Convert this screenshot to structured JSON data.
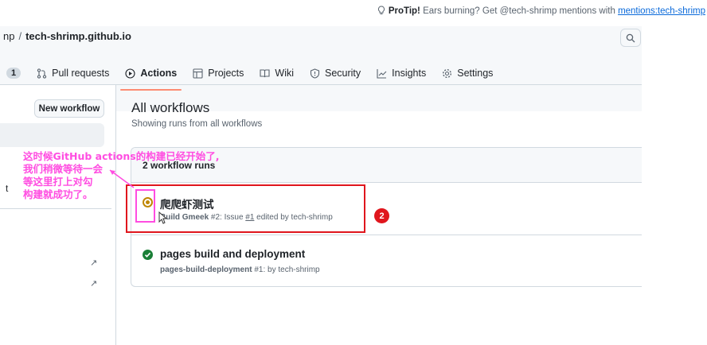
{
  "protip": {
    "label": "ProTip!",
    "text": "Ears burning? Get @tech-shrimp mentions with",
    "link": "mentions:tech-shrimp"
  },
  "breadcrumb": {
    "owner": "np",
    "separator": "/",
    "repo": "tech-shrimp.github.io"
  },
  "tabs": [
    {
      "label": "",
      "counter": "1"
    },
    {
      "label": "Pull requests"
    },
    {
      "label": "Actions"
    },
    {
      "label": "Projects"
    },
    {
      "label": "Wiki"
    },
    {
      "label": "Security"
    },
    {
      "label": "Insights"
    },
    {
      "label": "Settings"
    }
  ],
  "sidebar": {
    "new_workflow": "New workflow",
    "fragment": "t",
    "ext1": "↗",
    "ext2": "↗"
  },
  "main": {
    "title": "All workflows",
    "subtitle": "Showing runs from all workflows",
    "runs_count": "2 workflow runs",
    "runs": [
      {
        "title": "爬爬虾测试",
        "workflow": "Build Gmeek",
        "meta": " #2: Issue ",
        "issue": "#1",
        "suffix": " edited by tech-shrimp",
        "status": "queued"
      },
      {
        "title": "pages build and deployment",
        "workflow": "pages-build-deployment",
        "meta": " #1: by tech-shrimp",
        "status": "success"
      }
    ]
  },
  "annotation": {
    "lines": [
      "这时候GitHub actions的构建已经开始了,",
      "我们稍微等待一会",
      "等这里打上对勾",
      "构建就成功了。"
    ],
    "badge": "2"
  },
  "colors": {
    "red": "#e0161d",
    "pink": "#ff4de1",
    "queued": "#bf8700",
    "success": "#1a7f37",
    "active_tab": "#fd8c73"
  }
}
